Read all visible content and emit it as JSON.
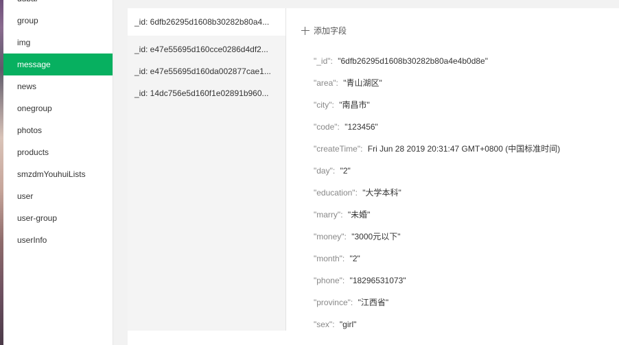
{
  "sidebar": {
    "items": [
      {
        "label": "dubai"
      },
      {
        "label": "group"
      },
      {
        "label": "img"
      },
      {
        "label": "message",
        "active": true
      },
      {
        "label": "news"
      },
      {
        "label": "onegroup"
      },
      {
        "label": "photos"
      },
      {
        "label": "products"
      },
      {
        "label": "smzdmYouhuiLists"
      },
      {
        "label": "user"
      },
      {
        "label": "user-group"
      },
      {
        "label": "userInfo"
      }
    ]
  },
  "records": [
    {
      "label": "_id: 6dfb26295d1608b30282b80a4..."
    },
    {
      "label": "_id: e47e55695d160cce0286d4df2..."
    },
    {
      "label": "_id: e47e55695d160da002877cae1..."
    },
    {
      "label": "_id: 14dc756e5d160f1e02891b960..."
    }
  ],
  "detail": {
    "add_field_label": "添加字段",
    "fields": [
      {
        "key": "\"_id\"",
        "value": "\"6dfb26295d1608b30282b80a4e4b0d8e\""
      },
      {
        "key": "\"area\"",
        "value": "\"青山湖区\""
      },
      {
        "key": "\"city\"",
        "value": "\"南昌市\""
      },
      {
        "key": "\"code\"",
        "value": "\"123456\""
      },
      {
        "key": "\"createTime\"",
        "value": "Fri Jun 28 2019 20:31:47 GMT+0800 (中国标准时间)"
      },
      {
        "key": "\"day\"",
        "value": "\"2\""
      },
      {
        "key": "\"education\"",
        "value": "\"大学本科\""
      },
      {
        "key": "\"marry\"",
        "value": "\"未婚\""
      },
      {
        "key": "\"money\"",
        "value": "\"3000元以下\""
      },
      {
        "key": "\"month\"",
        "value": "\"2\""
      },
      {
        "key": "\"phone\"",
        "value": "\"18296531073\""
      },
      {
        "key": "\"province\"",
        "value": "\"江西省\""
      },
      {
        "key": "\"sex\"",
        "value": "\"girl\""
      }
    ]
  },
  "colors": {
    "accent": "#07b060"
  }
}
